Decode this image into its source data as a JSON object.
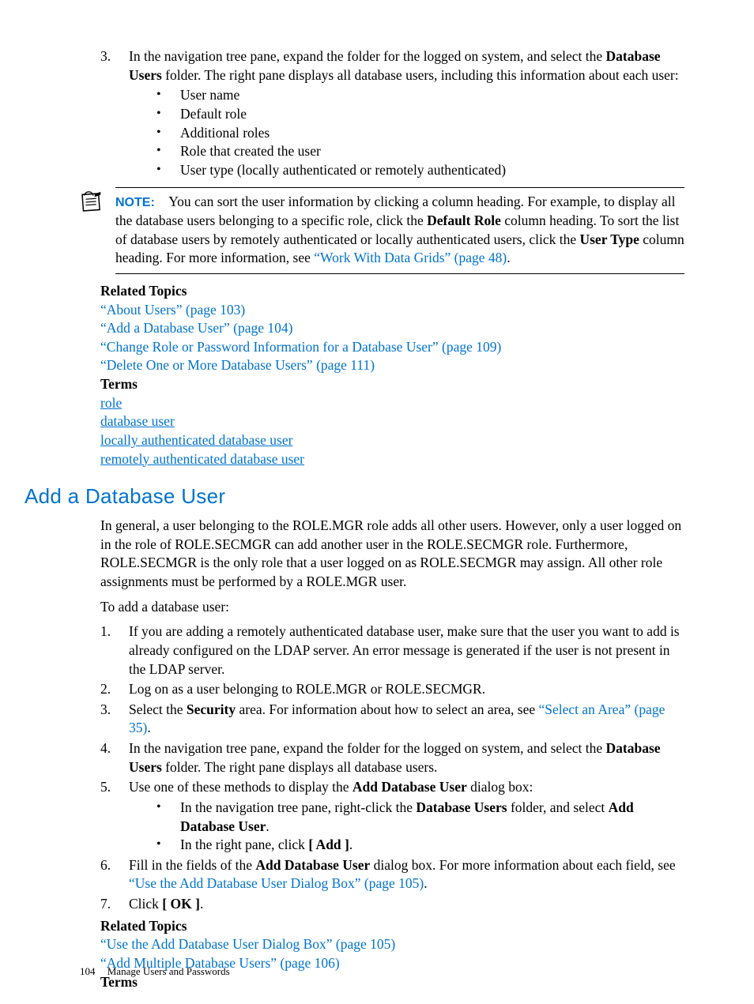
{
  "top": {
    "step3": {
      "num": "3.",
      "text_pre": "In the navigation tree pane, expand the folder for the logged on system, and select the ",
      "bold1": "Database Users",
      "text_post": " folder. The right pane displays all database users, including this information about each user:",
      "bullets": [
        "User name",
        "Default role",
        "Additional roles",
        "Role that created the user",
        "User type (locally authenticated or remotely authenticated)"
      ]
    }
  },
  "note": {
    "label": "NOTE:",
    "t1": "You can sort the user information by clicking a column heading. For example, to display all the database users belonging to a specific role, click the ",
    "b1": "Default Role",
    "t2": " column heading. To sort the list of database users by remotely authenticated or locally authenticated users, click the ",
    "b2": "User Type",
    "t3": " column heading. For more information, see ",
    "link": "“Work With Data Grids” (page 48)",
    "t4": "."
  },
  "related1": {
    "heading": "Related Topics",
    "links": [
      "“About Users” (page 103)",
      "“Add a Database User” (page 104)",
      "“Change Role or Password Information for a Database User” (page 109)",
      "“Delete One or More Database Users” (page 111)"
    ],
    "terms_heading": "Terms",
    "terms": [
      "role",
      "database user",
      "locally authenticated database user",
      "remotely authenticated database user"
    ]
  },
  "section": {
    "title": "Add a Database User",
    "intro1": "In general, a user belonging to the ROLE.MGR role adds all other users. However, only a user logged on in the role of ROLE.SECMGR can add another user in the ROLE.SECMGR role. Furthermore, ROLE.SECMGR is the only role that a user logged on as ROLE.SECMGR may assign. All other role assignments must be performed by a ROLE.MGR user.",
    "intro2": "To add a database user:",
    "steps": {
      "s1": {
        "num": "1.",
        "text": "If you are adding a remotely authenticated database user, make sure that the user you want to add is already configured on the LDAP server. An error message is generated if the user is not present in the LDAP server."
      },
      "s2": {
        "num": "2.",
        "text": "Log on as a user belonging to ROLE.MGR or ROLE.SECMGR."
      },
      "s3": {
        "num": "3.",
        "pre": "Select the ",
        "b": "Security",
        "post": " area. For information about how to select an area, see ",
        "link": "“Select an Area” (page 35)",
        "tail": "."
      },
      "s4": {
        "num": "4.",
        "pre": "In the navigation tree pane, expand the folder for the logged on system, and select the ",
        "b": "Database Users",
        "post": " folder. The right pane displays all database users."
      },
      "s5": {
        "num": "5.",
        "pre": "Use one of these methods to display the ",
        "b": "Add Database User",
        "post": " dialog box:",
        "bul_a_pre": "In the navigation tree pane, right-click the ",
        "bul_a_b1": "Database Users",
        "bul_a_mid": " folder, and select ",
        "bul_a_b2": "Add Database User",
        "bul_a_post": ".",
        "bul_b_pre": "In the right pane, click ",
        "bul_b_b": "[ Add ]",
        "bul_b_post": "."
      },
      "s6": {
        "num": "6.",
        "pre": "Fill in the fields of the ",
        "b": "Add Database User",
        "post": " dialog box. For more information about each field, see ",
        "link": "“Use the Add Database User Dialog Box” (page 105)",
        "tail": "."
      },
      "s7": {
        "num": "7.",
        "pre": "Click ",
        "b": "[ OK ]",
        "post": "."
      }
    }
  },
  "related2": {
    "heading": "Related Topics",
    "links": [
      "“Use the Add Database User Dialog Box” (page 105)",
      "“Add Multiple Database Users” (page 106)"
    ],
    "terms_heading": "Terms"
  },
  "footer": {
    "page": "104",
    "chapter": "Manage Users and Passwords"
  }
}
